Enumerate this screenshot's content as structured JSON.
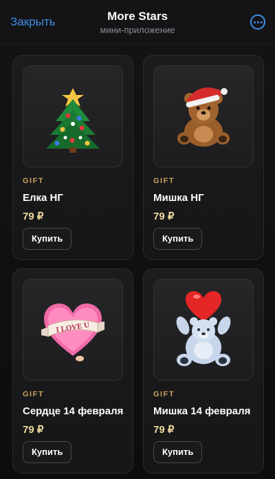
{
  "header": {
    "close_label": "Закрыть",
    "title": "More Stars",
    "subtitle": "мини-приложение",
    "accent_color": "#3e8fe8"
  },
  "products": [
    {
      "kind": "GIFT",
      "name": "Елка НГ",
      "price": "79 ₽",
      "buy_label": "Купить",
      "icon": "christmas-tree-icon"
    },
    {
      "kind": "GIFT",
      "name": "Мишка НГ",
      "price": "79 ₽",
      "buy_label": "Купить",
      "icon": "teddy-bear-santa-hat-icon"
    },
    {
      "kind": "GIFT",
      "name": "Сердце 14 февраля",
      "price": "79 ₽",
      "buy_label": "Купить",
      "icon": "love-heart-banner-icon"
    },
    {
      "kind": "GIFT",
      "name": "Мишка 14 февраля",
      "price": "79 ₽",
      "buy_label": "Купить",
      "icon": "bear-with-heart-icon"
    }
  ],
  "heart_banner_text": "I LOVE U"
}
